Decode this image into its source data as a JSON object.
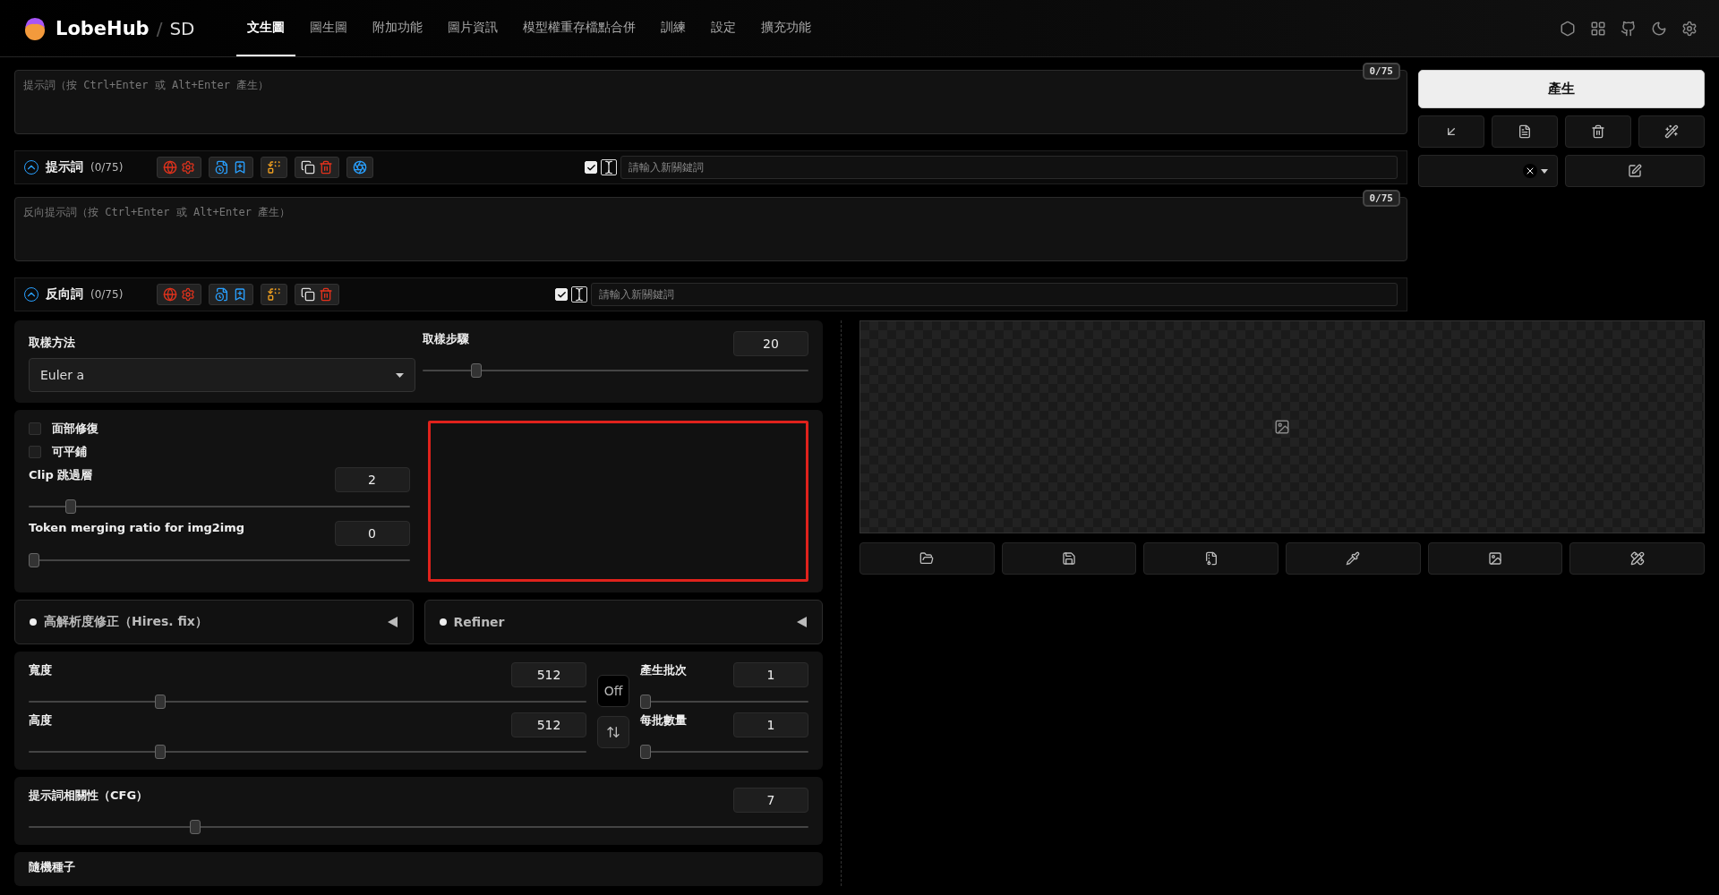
{
  "header": {
    "logo": "LobeHub",
    "separator": "/",
    "product": "SD",
    "tabs": [
      {
        "label": "文生圖",
        "selected": true
      },
      {
        "label": "圖生圖",
        "selected": false
      },
      {
        "label": "附加功能",
        "selected": false
      },
      {
        "label": "圖片資訊",
        "selected": false
      },
      {
        "label": "模型權重存檔點合併",
        "selected": false
      },
      {
        "label": "訓練",
        "selected": false
      },
      {
        "label": "設定",
        "selected": false
      },
      {
        "label": "擴充功能",
        "selected": false
      }
    ]
  },
  "prompts": [
    {
      "placeholder": "提示詞（按 Ctrl+Enter 或 Alt+Enter 產生）",
      "counter": "0/75",
      "toolbar": {
        "expanded": true,
        "title": "提示詞",
        "count": "(0/75)",
        "tool_groups": [
          {
            "kind": "translate"
          },
          {
            "kind": "bookmarks"
          },
          {
            "kind": "swap"
          },
          {
            "kind": "clipboard"
          },
          {
            "kind": "assistant"
          }
        ],
        "keyword_checked": true,
        "keyword_placeholder": "請輸入新關鍵詞"
      }
    },
    {
      "placeholder": "反向提示詞（按 Ctrl+Enter 或 Alt+Enter 產生）",
      "counter": "0/75",
      "toolbar": {
        "expanded": true,
        "title": "反向詞",
        "count": "(0/75)",
        "tool_groups": [
          {
            "kind": "translate"
          },
          {
            "kind": "bookmarks"
          },
          {
            "kind": "swap"
          },
          {
            "kind": "clipboard"
          }
        ],
        "keyword_checked": true,
        "keyword_placeholder": "請輸入新關鍵詞"
      }
    }
  ],
  "actions": {
    "generate": "產生"
  },
  "sampling": {
    "method_label": "取樣方法",
    "method": "Euler a",
    "steps": {
      "label": "取樣步驟",
      "value": "20",
      "level": 0.13
    }
  },
  "options": {
    "checkboxes": [
      {
        "label": "面部修復",
        "checked": false
      },
      {
        "label": "可平鋪",
        "checked": false
      }
    ],
    "sliders": [
      {
        "label": "Clip 跳過層",
        "value": "2",
        "level": 0.1
      },
      {
        "label": "Token merging ratio for img2img",
        "value": "0",
        "level": 0
      }
    ]
  },
  "accordions": [
    {
      "title": "高解析度修正（Hires. fix）",
      "expanded": false
    },
    {
      "title": "Refiner",
      "expanded": false
    }
  ],
  "size": {
    "sliders": [
      {
        "label": "寬度",
        "value": "512",
        "level": 0.23
      },
      {
        "label": "高度",
        "value": "512",
        "level": 0.23
      }
    ],
    "toggle": "Off",
    "batch": [
      {
        "label": "產生批次",
        "value": "1",
        "level": 0
      },
      {
        "label": "每批數量",
        "value": "1",
        "level": 0
      }
    ]
  },
  "cfg": {
    "label": "提示詞相關性（CFG）",
    "value": "7",
    "level": 0.21
  },
  "seed": {
    "label": "隨機種子"
  }
}
